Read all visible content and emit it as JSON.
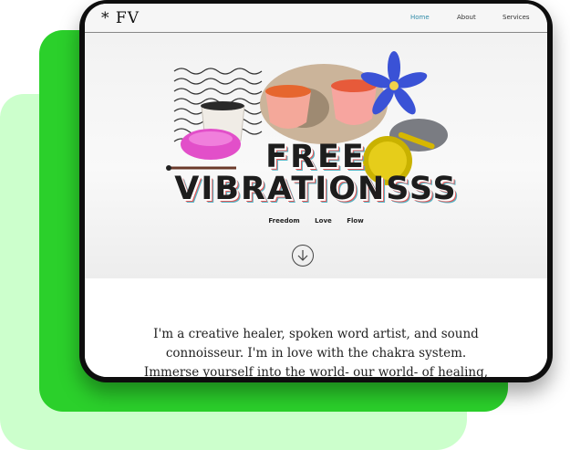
{
  "site": {
    "logo": "* FV"
  },
  "nav": {
    "items": [
      {
        "label": "Home",
        "active": true
      },
      {
        "label": "About",
        "active": false
      },
      {
        "label": "Services",
        "active": false
      }
    ]
  },
  "hero": {
    "title_line1": "FREE",
    "title_line2": "VIBRATIONSSS",
    "tags": [
      "Freedom",
      "Love",
      "Flow"
    ]
  },
  "intro": {
    "text": "I'm a creative healer, spoken word artist, and sound connoisseur. I'm in love with the chakra system. Immerse yourself into the world- our world- of healing, living and being. And see you on the"
  },
  "colors": {
    "backdrop_green": "#2bd02b",
    "backdrop_light_green": "#ccffcc",
    "nav_active": "#2f8ba8",
    "title_shadow_red": "#e25a5a",
    "title_shadow_teal": "#56b5c6"
  }
}
